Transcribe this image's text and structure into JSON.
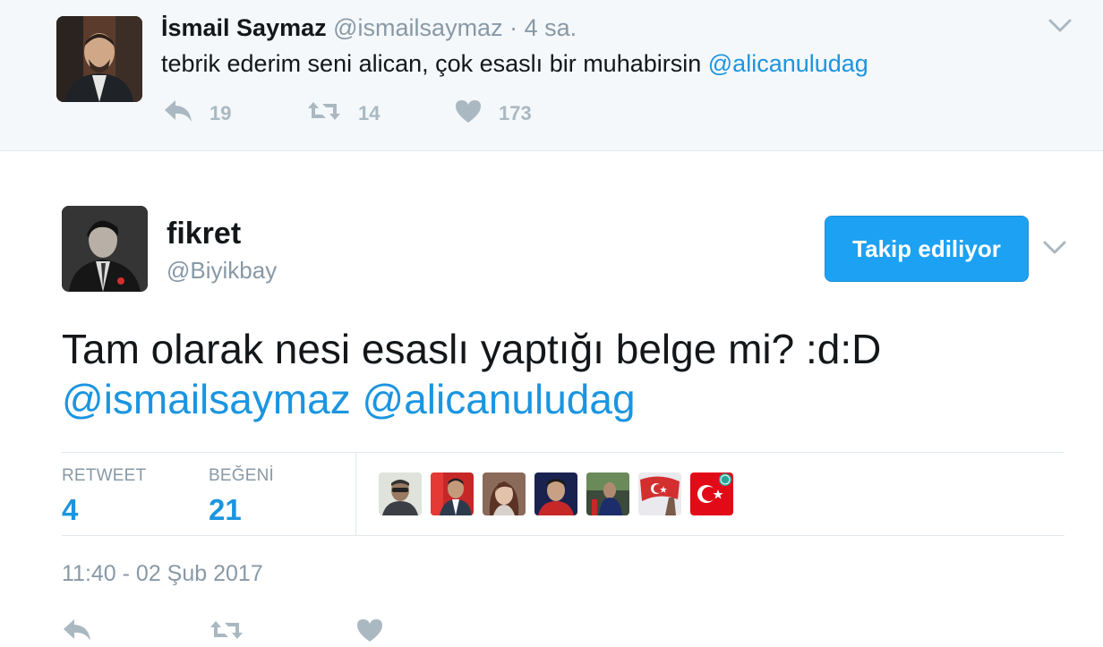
{
  "parent_tweet": {
    "name": "İsmail Saymaz",
    "handle": "@ismailsaymaz",
    "separator": "·",
    "time": "4 sa.",
    "text": "tebrik ederim seni alican, çok esaslı bir muhabirsin ",
    "mention": "@alicanuludag",
    "reply_count": "19",
    "retweet_count": "14",
    "like_count": "173"
  },
  "main_tweet": {
    "name": "fikret",
    "handle": "@Biyikbay",
    "follow_button": "Takip ediliyor",
    "text_line1": "Tam olarak nesi esaslı yaptığı belge mi? :d:D",
    "mention1": "@ismailsaymaz",
    "mention2": "@alicanuludag",
    "retweet_label": "RETWEET",
    "retweet_value": "4",
    "like_label": "BEĞENİ",
    "like_value": "21",
    "timestamp": "11:40 - 02 Şub 2017"
  },
  "colors": {
    "accent": "#1b95e0",
    "button": "#1da1f2",
    "muted": "#8899a6",
    "parent_bg": "#f5f8fa"
  },
  "liker_avatars": [
    "avatar-1",
    "avatar-2",
    "avatar-3",
    "avatar-4",
    "avatar-5",
    "avatar-6",
    "avatar-7"
  ]
}
